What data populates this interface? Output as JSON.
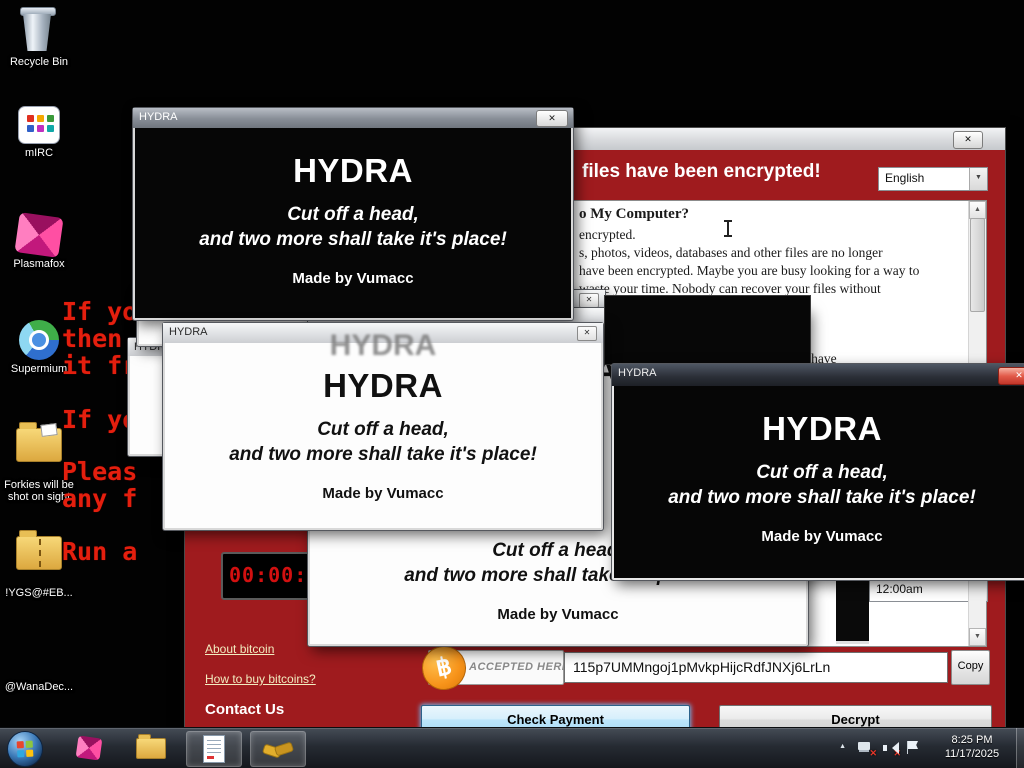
{
  "icons": {
    "close": "✕",
    "arrow_up": "▲",
    "arrow_down": "▼",
    "tray_chevron": "▲"
  },
  "desktop": {
    "icons": {
      "recycle_bin": "Recycle Bin",
      "mirc": "mIRC",
      "plasmafox": "Plasmafox",
      "supermium": "Supermium",
      "forkies": "Forkies will be shot on sight",
      "ygs": "!YGS@#EB...",
      "wanadec": "@WanaDec..."
    },
    "graffiti": [
      "If yo",
      "then yo",
      "it fr",
      "If yo",
      "Pleas",
      "any f",
      "Run a"
    ]
  },
  "hydra": {
    "window_title": "HYDRA",
    "heading": "HYDRA",
    "tagline1": "Cut off a head,",
    "tagline2": "and two more shall take it's place!",
    "byline": "Made by Vumacc"
  },
  "ransom": {
    "header_fragment": "files have been encrypted!",
    "language": "English",
    "q1_fragment": "o My Computer?",
    "body1": "encrypted.",
    "body2": "s, photos, videos, databases and other files are no longer",
    "body3": "have been encrypted. Maybe you are busy looking for a way to",
    "body4": "waste your time. Nobody can recover your files without",
    "q2_fragment": "?",
    "body5": "your files safely and easily. But you have",
    "timer": "00:00:",
    "link_about": "About bitcoin",
    "link_how": "How to buy bitcoins?",
    "link_contact": "Contact Us",
    "bitcoin_symbol": "฿",
    "bitcoin_badge": "ACCEPTED HERE",
    "address": "115p7UMMngoj1pMvkpHijcRdfJNXj6LrLn",
    "copy": "Copy",
    "check_payment": "Check Payment",
    "decrypt": "Decrypt",
    "combo_value": "12:00am"
  },
  "taskbar": {
    "time": "8:25 PM",
    "date": "11/17/2025"
  }
}
